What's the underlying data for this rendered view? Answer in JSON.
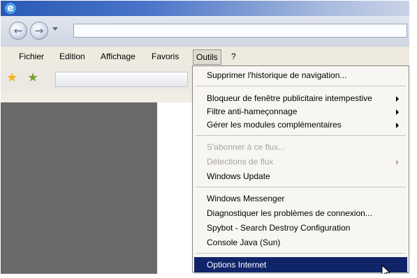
{
  "window": {
    "icon": "ie-logo-icon",
    "address_value": ""
  },
  "menubar": {
    "items": [
      "Fichier",
      "Edition",
      "Affichage",
      "Favoris",
      "Outils",
      "?"
    ],
    "active": "Outils"
  },
  "tools_menu": {
    "groups": [
      {
        "items": [
          {
            "label": "Supprimer l'historique de navigation...",
            "enabled": true,
            "submenu": false
          }
        ]
      },
      {
        "items": [
          {
            "label": "Bloqueur de fenêtre publicitaire intempestive",
            "enabled": true,
            "submenu": true
          },
          {
            "label": "Filtre anti-hameçonnage",
            "enabled": true,
            "submenu": true
          },
          {
            "label": "Gérer les modules complémentaires",
            "enabled": true,
            "submenu": true
          }
        ]
      },
      {
        "items": [
          {
            "label": "S'abonner à ce flux...",
            "enabled": false,
            "submenu": false
          },
          {
            "label": "Détections de flux",
            "enabled": false,
            "submenu": true
          },
          {
            "label": "Windows Update",
            "enabled": true,
            "submenu": false
          }
        ]
      },
      {
        "items": [
          {
            "label": "Windows Messenger",
            "enabled": true,
            "submenu": false
          },
          {
            "label": "Diagnostiquer les problèmes de connexion...",
            "enabled": true,
            "submenu": false
          },
          {
            "label": "Spybot - Search  Destroy Configuration",
            "enabled": true,
            "submenu": false
          },
          {
            "label": "Console Java (Sun)",
            "enabled": true,
            "submenu": false
          }
        ]
      },
      {
        "items": [
          {
            "label": "Options Internet",
            "enabled": true,
            "submenu": false,
            "highlighted": true
          }
        ]
      }
    ]
  },
  "colors": {
    "highlight": "#10246a",
    "menu_bg": "#f7f6f3",
    "content_left": "#6a6a6a"
  }
}
